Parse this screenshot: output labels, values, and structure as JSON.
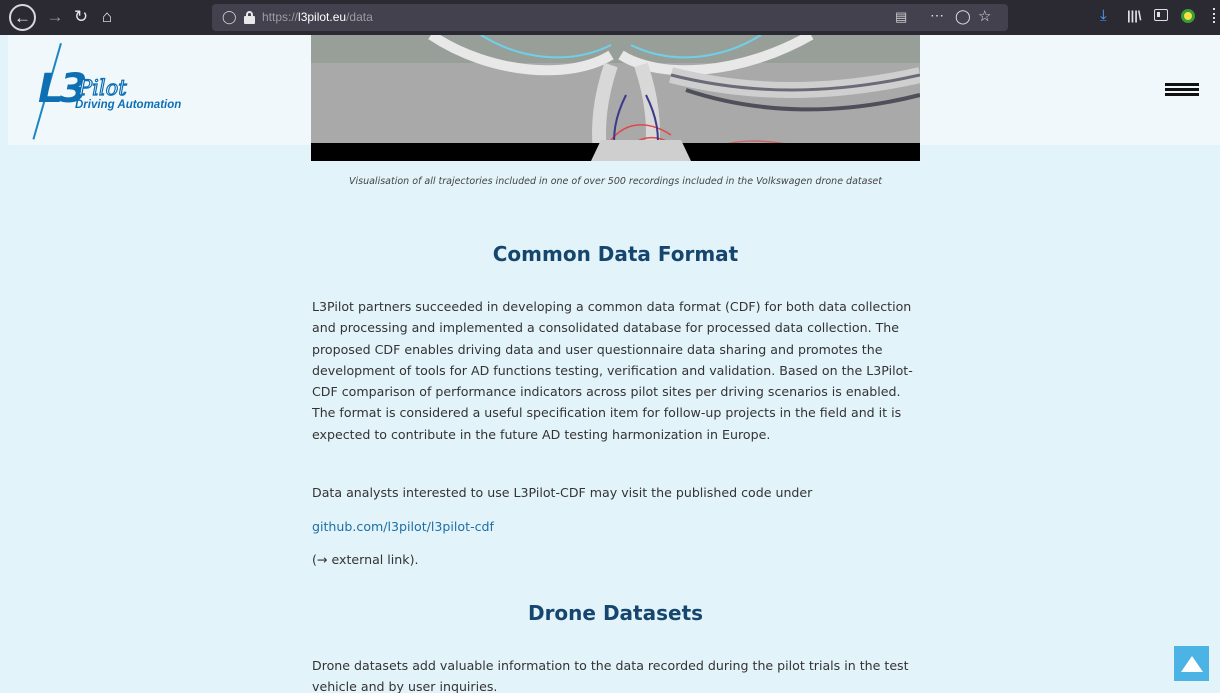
{
  "browser": {
    "url_prefix": "https://",
    "url_host": "l3pilot.eu",
    "url_path": "/data",
    "icons": [
      "back-icon",
      "forward-icon",
      "reload-icon",
      "home-icon",
      "shield-icon",
      "lock-icon",
      "reader-view-icon",
      "more-actions-icon",
      "pocket-icon",
      "bookmark-star-icon",
      "download-icon",
      "library-icon",
      "sidebar-icon",
      "extension-icon",
      "menu-icon"
    ]
  },
  "header": {
    "logo_l3": "L3",
    "logo_pilot": "Pilot",
    "logo_tagline": "Driving Automation",
    "brand_color": "#0f6fb3"
  },
  "hero": {
    "caption": "Visualisation of all trajectories included in one of over 500 recordings included in the Volkswagen drone dataset"
  },
  "sections": {
    "cdf_heading": "Common Data Format",
    "cdf_text": "L3Pilot partners succeeded in developing a common data format (CDF) for both data collection and processing and implemented a consolidated database for processed data collection. The proposed CDF enables driving data and user questionnaire data sharing and promotes the development of tools for AD functions testing, verification and validation. Based on the L3Pilot-CDF comparison of performance indicators across pilot sites per driving scenarios is enabled. The format is considered a useful specification item for follow-up projects in the field and it is expected to contribute in the future AD testing harmonization in Europe.",
    "cdf_text2": "Data analysts interested to use L3Pilot-CDF may visit the published code under",
    "cdf_link": "github.com/l3pilot/l3pilot-cdf",
    "cdf_link_note": "(→ external link).",
    "drone_heading": "Drone Datasets",
    "drone_text": "Drone datasets add valuable information to the data recorded during the pilot trials in the test vehicle and by user inquiries."
  },
  "colors": {
    "page_bg": "#e3f3fa",
    "heading": "#16466e",
    "link": "#1d6fa5",
    "scroll_button": "#4cb3e5"
  }
}
